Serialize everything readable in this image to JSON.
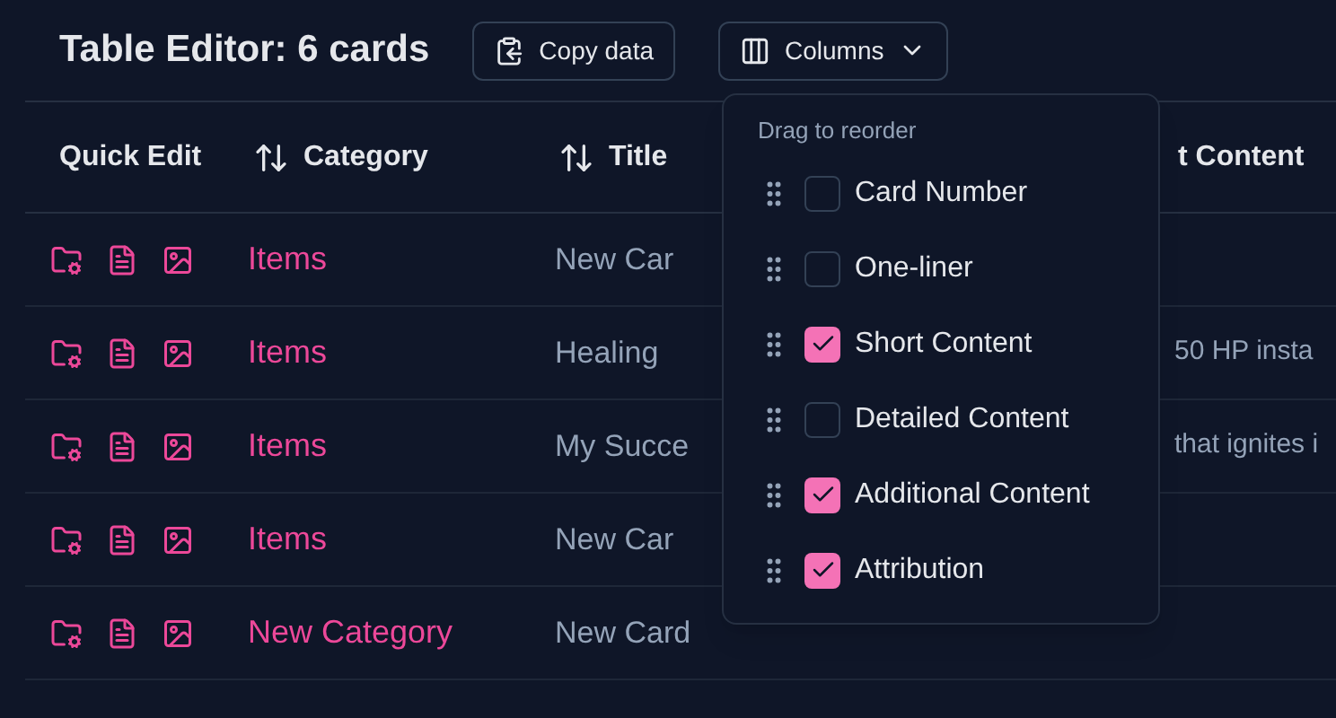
{
  "title": "Table Editor: 6 cards",
  "toolbar": [
    {
      "label": "Copy data",
      "kind": "copy"
    },
    {
      "label": "Columns",
      "kind": "columns"
    }
  ],
  "table": {
    "columns": [
      {
        "label": "Quick Edit",
        "sortable": false
      },
      {
        "label": "Category",
        "sortable": true
      },
      {
        "label": "Title",
        "sortable": true
      },
      {
        "label": "t Content",
        "sortable": false
      }
    ],
    "rows": [
      {
        "category": "Items",
        "title": "New Car",
        "content": ""
      },
      {
        "category": "Items",
        "title": "Healing",
        "content": "50 HP insta"
      },
      {
        "category": "Items",
        "title": "My Succe",
        "content": "that ignites i"
      },
      {
        "category": "Items",
        "title": "New Car",
        "content": ""
      },
      {
        "category": "New Category",
        "title": "New Card",
        "content": ""
      }
    ]
  },
  "columns_menu": {
    "hint": "Drag to reorder",
    "items": [
      {
        "label": "Card Number",
        "checked": false
      },
      {
        "label": "One-liner",
        "checked": false
      },
      {
        "label": "Short Content",
        "checked": true
      },
      {
        "label": "Detailed Content",
        "checked": false
      },
      {
        "label": "Additional Content",
        "checked": true
      },
      {
        "label": "Attribution",
        "checked": true
      }
    ]
  }
}
